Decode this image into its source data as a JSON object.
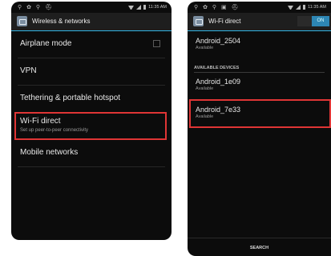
{
  "left": {
    "status": {
      "time": "11:35 AM"
    },
    "header": {
      "title": "Wireless & networks"
    },
    "items": [
      {
        "title": "Airplane mode"
      },
      {
        "title": "VPN"
      },
      {
        "title": "Tethering & portable hotspot"
      },
      {
        "title": "Wi-Fi direct",
        "subtitle": "Set up peer-to-peer connectivity"
      },
      {
        "title": "Mobile networks"
      }
    ]
  },
  "right": {
    "status": {
      "time": "11:35 AM"
    },
    "header": {
      "title": "Wi-Fi direct",
      "toggle": "ON"
    },
    "this_device": {
      "name": "Android_2504",
      "status": "Available"
    },
    "section_label": "AVAILABLE DEVICES",
    "devices": [
      {
        "name": "Android_1e09",
        "status": "Available"
      },
      {
        "name": "Android_7e33",
        "status": "Available"
      }
    ],
    "bottom_button": "SEARCH"
  },
  "colors": {
    "accent": "#33b5e5",
    "highlight": "#e03535",
    "toggle_on": "#2d86b4"
  }
}
